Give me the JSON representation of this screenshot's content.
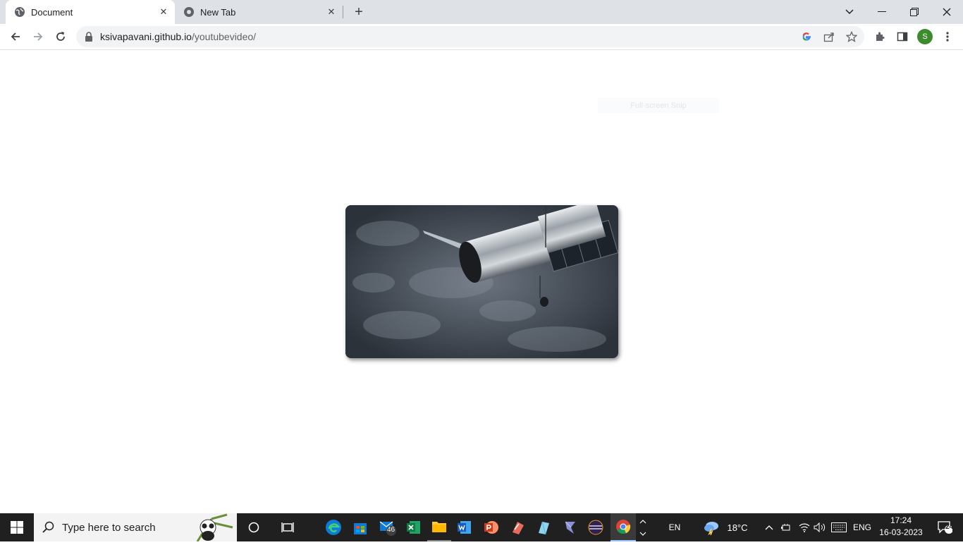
{
  "browser": {
    "tabs": [
      {
        "title": "Document",
        "active": true
      },
      {
        "title": "New Tab",
        "active": false
      }
    ],
    "url_host": "ksivapavani.github.io",
    "url_path": "/youtubevideo/",
    "profile_initial": "S"
  },
  "page": {
    "overlay_hint": "Full-screen Snip"
  },
  "taskbar": {
    "search_placeholder": "Type here to search",
    "mail_badge": "46",
    "lang_short": "EN",
    "weather_temp": "18°C",
    "input_lang": "ENG",
    "time": "17:24",
    "date": "16-03-2023",
    "notification_count": "24"
  },
  "colors": {
    "tabstrip_bg": "#dee1e6",
    "taskbar_bg": "#202020",
    "accent_green": "#3c8b2e"
  }
}
